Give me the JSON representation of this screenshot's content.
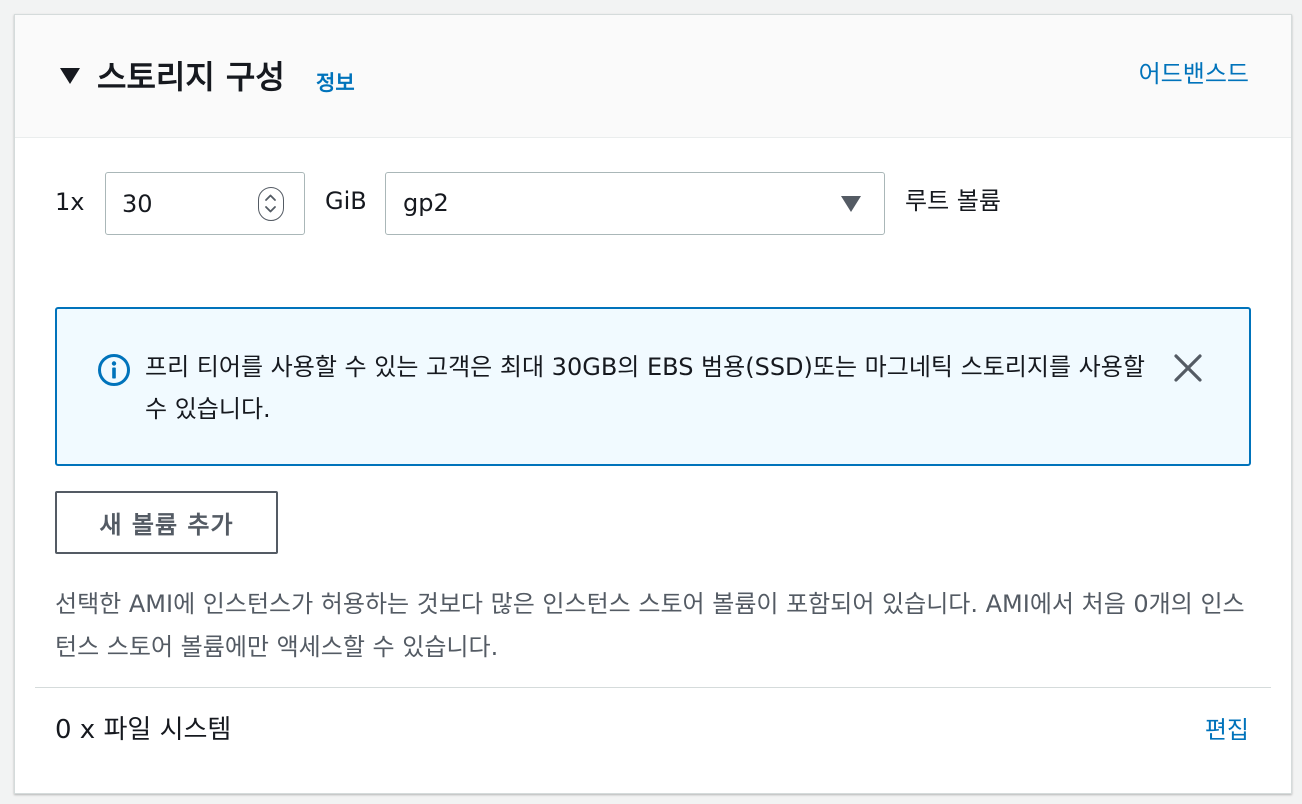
{
  "header": {
    "title": "스토리지 구성",
    "info_label": "정보",
    "advanced_label": "어드밴스드",
    "collapse_icon": "caret-down-icon"
  },
  "root_volume": {
    "count_label": "1x",
    "size_value": "30",
    "unit_label": "GiB",
    "volume_type": "gp2",
    "volume_label": "루트 볼륨"
  },
  "alert": {
    "type": "info",
    "icon": "info-icon",
    "text": "프리 티어를 사용할 수 있는 고객은 최대 30GB의 EBS 범용(SSD)또는 마그네틱 스토리지를 사용할 수 있습니다.",
    "close_icon": "close-icon"
  },
  "add_volume_button": "새 볼륨 추가",
  "note": "선택한 AMI에 인스턴스가 허용하는 것보다 많은 인스턴스 스토어 볼륨이 포함되어 있습니다. AMI에서 처음 0개의 인스턴스 스토어 볼륨에만 액세스할 수 있습니다.",
  "file_systems": {
    "label": "0 x 파일 시스템",
    "edit_label": "편집"
  },
  "colors": {
    "link": "#0073bb",
    "alert_bg": "#f1faff",
    "alert_border": "#0073bb",
    "header_bg": "#fafafa",
    "secondary_text": "#545b64"
  }
}
